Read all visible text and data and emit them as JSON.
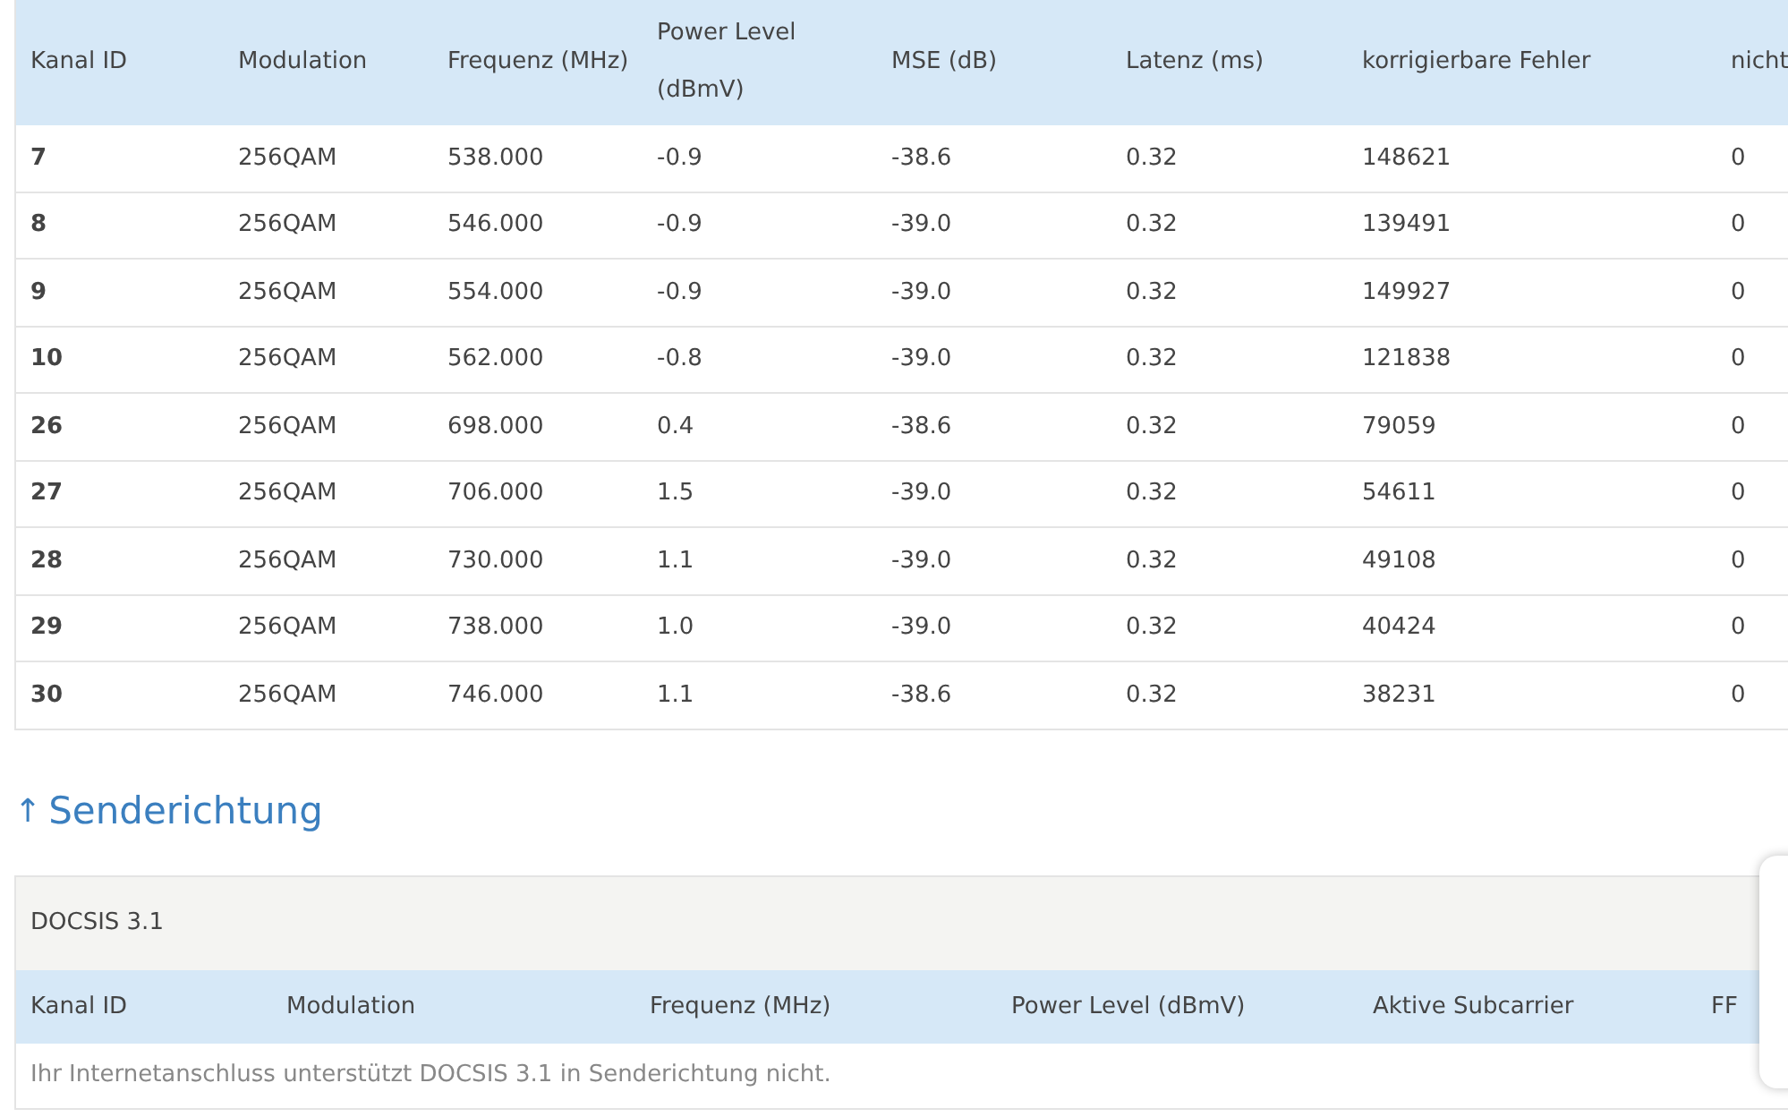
{
  "downstream_table": {
    "columns": [
      "Kanal ID",
      "Modulation",
      "Frequenz (MHz)",
      "Power Level (dBmV)",
      "MSE (dB)",
      "Latenz (ms)",
      "korrigierbare Fehler",
      "nicht"
    ],
    "rows": [
      [
        "7",
        "256QAM",
        "538.000",
        "-0.9",
        "-38.6",
        "0.32",
        "148621",
        "0"
      ],
      [
        "8",
        "256QAM",
        "546.000",
        "-0.9",
        "-39.0",
        "0.32",
        "139491",
        "0"
      ],
      [
        "9",
        "256QAM",
        "554.000",
        "-0.9",
        "-39.0",
        "0.32",
        "149927",
        "0"
      ],
      [
        "10",
        "256QAM",
        "562.000",
        "-0.8",
        "-39.0",
        "0.32",
        "121838",
        "0"
      ],
      [
        "26",
        "256QAM",
        "698.000",
        "0.4",
        "-38.6",
        "0.32",
        "79059",
        "0"
      ],
      [
        "27",
        "256QAM",
        "706.000",
        "1.5",
        "-39.0",
        "0.32",
        "54611",
        "0"
      ],
      [
        "28",
        "256QAM",
        "730.000",
        "1.1",
        "-39.0",
        "0.32",
        "49108",
        "0"
      ],
      [
        "29",
        "256QAM",
        "738.000",
        "1.0",
        "-39.0",
        "0.32",
        "40424",
        "0"
      ],
      [
        "30",
        "256QAM",
        "746.000",
        "1.1",
        "-38.6",
        "0.32",
        "38231",
        "0"
      ]
    ]
  },
  "upstream_section": {
    "heading_icon": "↑",
    "heading": "Senderichtung",
    "panel_title": "DOCSIS 3.1",
    "columns": [
      "Kanal ID",
      "Modulation",
      "Frequenz (MHz)",
      "Power Level (dBmV)",
      "Aktive Subcarrier",
      "FF"
    ],
    "message": "Ihr Internetanschluss unterstützt DOCSIS 3.1 in Senderichtung nicht."
  }
}
